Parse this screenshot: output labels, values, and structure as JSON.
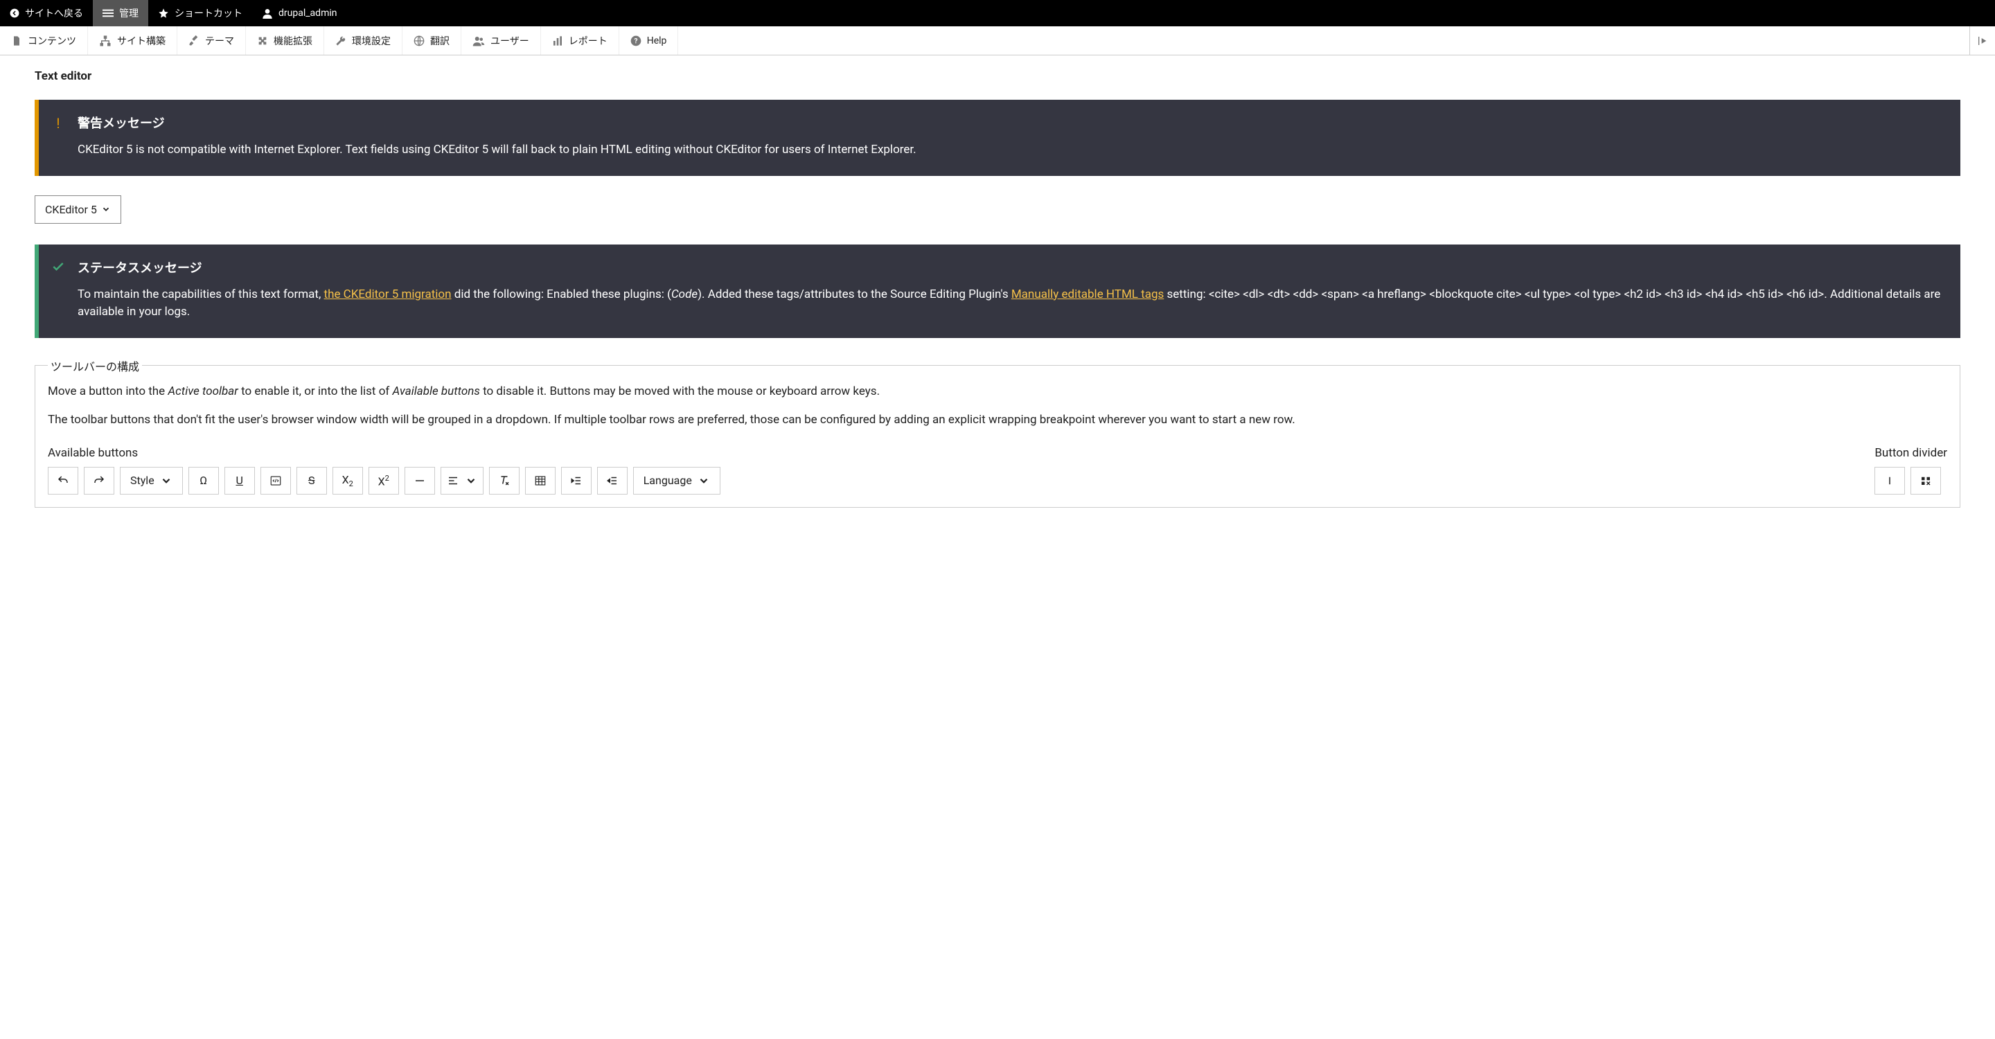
{
  "topbar": {
    "back": "サイトへ戻る",
    "manage": "管理",
    "shortcuts": "ショートカット",
    "user": "drupal_admin"
  },
  "adminbar": {
    "content": "コンテンツ",
    "structure": "サイト構築",
    "appearance": "テーマ",
    "extend": "機能拡張",
    "config": "環境設定",
    "translate": "翻訳",
    "people": "ユーザー",
    "reports": "レポート",
    "help": "Help"
  },
  "section_title": "Text editor",
  "warning": {
    "title": "警告メッセージ",
    "body": "CKEditor 5 is not compatible with Internet Explorer. Text fields using CKEditor 5 will fall back to plain HTML editing without CKEditor for users of Internet Explorer."
  },
  "editor_select": "CKEditor 5",
  "status": {
    "title": "ステータスメッセージ",
    "pre": "To maintain the capabilities of this text format, ",
    "link1": "the CKEditor 5 migration",
    "mid1": " did the following: Enabled these plugins: (",
    "code_em": "Code",
    "mid2": "). Added these tags/attributes to the Source Editing Plugin's ",
    "link2": "Manually editable HTML tags",
    "post": " setting: <cite> <dl> <dt> <dd> <span> <a hreflang> <blockquote cite> <ul type> <ol type> <h2 id> <h3 id> <h4 id> <h5 id> <h6 id>. Additional details are available in your logs."
  },
  "fieldset": {
    "legend": "ツールバーの構成",
    "desc1_pre": "Move a button into the ",
    "desc1_em1": "Active toolbar",
    "desc1_mid": " to enable it, or into the list of ",
    "desc1_em2": "Available buttons",
    "desc1_post": " to disable it. Buttons may be moved with the mouse or keyboard arrow keys.",
    "desc2": "The toolbar buttons that don't fit the user's browser window width will be grouped in a dropdown. If multiple toolbar rows are preferred, those can be configured by adding an explicit wrapping breakpoint wherever you want to start a new row.",
    "available_label": "Available buttons",
    "divider_label": "Button divider",
    "style_label": "Style",
    "language_label": "Language"
  }
}
